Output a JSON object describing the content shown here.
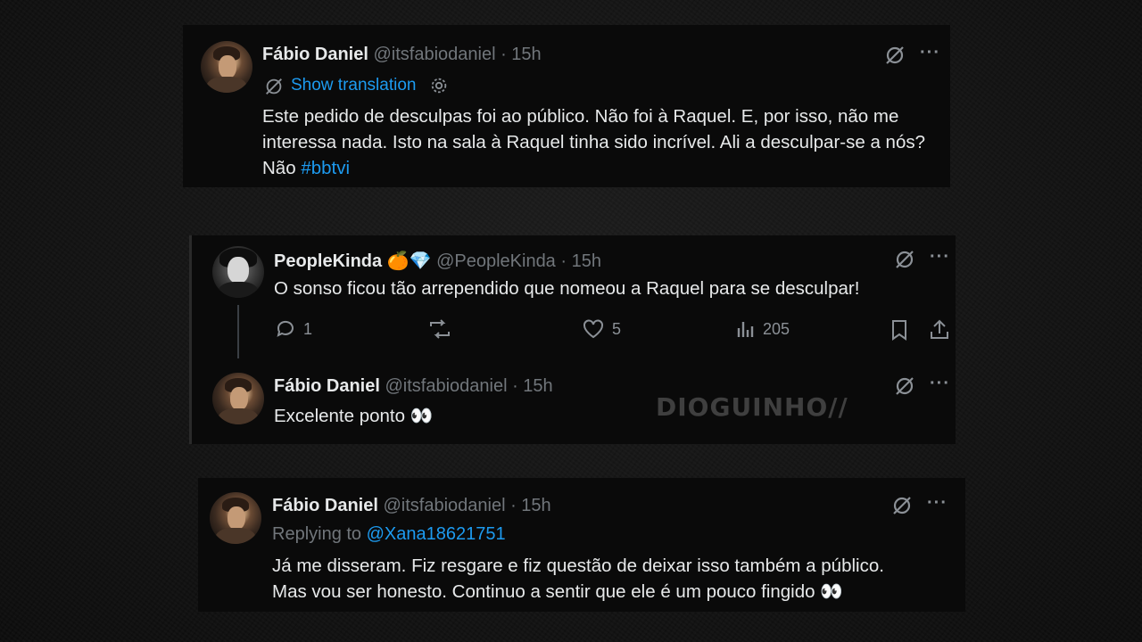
{
  "tweet1": {
    "name": "Fábio Daniel",
    "handle": "@itsfabiodaniel",
    "time": "· 15h",
    "show_translation": "Show translation",
    "text_before": "Este pedido de desculpas foi ao público. Não foi à Raquel. E, por isso, não me interessa nada. Isto na sala à Raquel tinha sido incrível. Ali a desculpar-se a nós? Não ",
    "hashtag": "#bbtvi"
  },
  "tweet2": {
    "name": "PeopleKinda",
    "emojis": "🍊💎",
    "handle": "@PeopleKinda",
    "time": "· 15h",
    "text": "O sonso ficou tão arrependido que nomeou a Raquel para se desculpar!",
    "reply_count": "1",
    "like_count": "5",
    "view_count": "205"
  },
  "tweet3": {
    "name": "Fábio Daniel",
    "handle": "@itsfabiodaniel",
    "time": "· 15h",
    "text": "Excelente ponto 👀"
  },
  "watermark": "DIOGUINHO//",
  "tweet4": {
    "name": "Fábio Daniel",
    "handle": "@itsfabiodaniel",
    "time": "· 15h",
    "replying_label": "Replying to",
    "replying_to": "@Xana18621751",
    "text_line1": "Já me disseram. Fiz resgare e fiz questão de deixar isso também a público.",
    "text_line2": "Mas vou ser honesto. Continuo a sentir que ele é um pouco fingido 👀"
  },
  "colors": {
    "link": "#1d9bf0",
    "muted": "#71767b",
    "card": "#0a0a0a"
  },
  "icons": [
    "grok-icon",
    "more-icon",
    "translate-icon",
    "settings-gear-icon",
    "reply-icon",
    "retweet-icon",
    "like-icon",
    "views-icon",
    "bookmark-icon",
    "share-icon"
  ]
}
